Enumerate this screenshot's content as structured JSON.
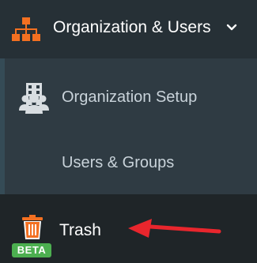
{
  "header": {
    "label": "Organization & Users",
    "icon": "org-chart-icon",
    "chevron": "chevron-down-icon",
    "accent_color": "#f37021"
  },
  "submenu": {
    "items": [
      {
        "label": "Organization Setup",
        "icon": "building-icon"
      },
      {
        "label": "Users & Groups",
        "icon": "users-icon"
      }
    ]
  },
  "trash": {
    "label": "Trash",
    "icon": "trash-icon",
    "badge": "BETA",
    "badge_color": "#4caf50",
    "icon_color": "#f37021"
  },
  "annotation": {
    "icon": "red-arrow-icon",
    "color": "#e8262d"
  }
}
